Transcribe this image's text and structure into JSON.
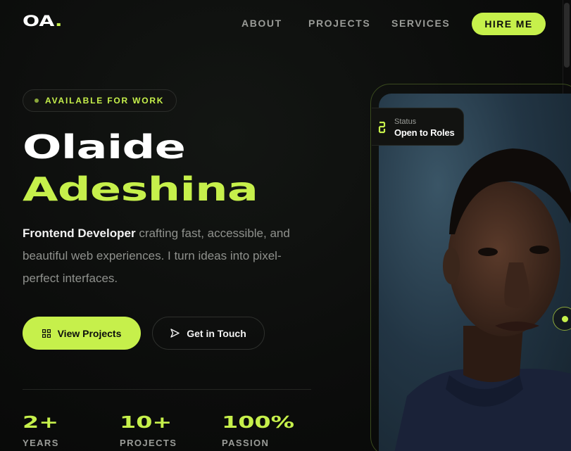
{
  "nav": {
    "logo_text": "OA",
    "logo_dot": ".",
    "links": [
      "ABOUT",
      "PROJECTS",
      "SERVICES"
    ],
    "cta": "HIRE ME"
  },
  "hero": {
    "badge": "AVAILABLE FOR WORK",
    "first_name": "Olaide",
    "last_name": "Adeshina",
    "role": "Frontend Developer",
    "bio": " crafting fast, accessible, and beautiful web experiences. I turn ideas into pixel-perfect interfaces.",
    "primary_cta": "View Projects",
    "primary_cta_icon": "grid-icon",
    "secondary_cta": "Get in Touch",
    "secondary_cta_icon": "send-icon"
  },
  "stats": [
    {
      "value": "2+",
      "label": "YEARS"
    },
    {
      "value": "10+",
      "label": "PROJECTS"
    },
    {
      "value": "100%",
      "label": "PASSION"
    }
  ],
  "status_card": {
    "label": "Status",
    "value": "Open to Roles",
    "icon": "code-bracket-icon"
  },
  "colors": {
    "accent": "#c6f04b",
    "background": "#0c0d0c",
    "muted_text": "#8f918d"
  }
}
